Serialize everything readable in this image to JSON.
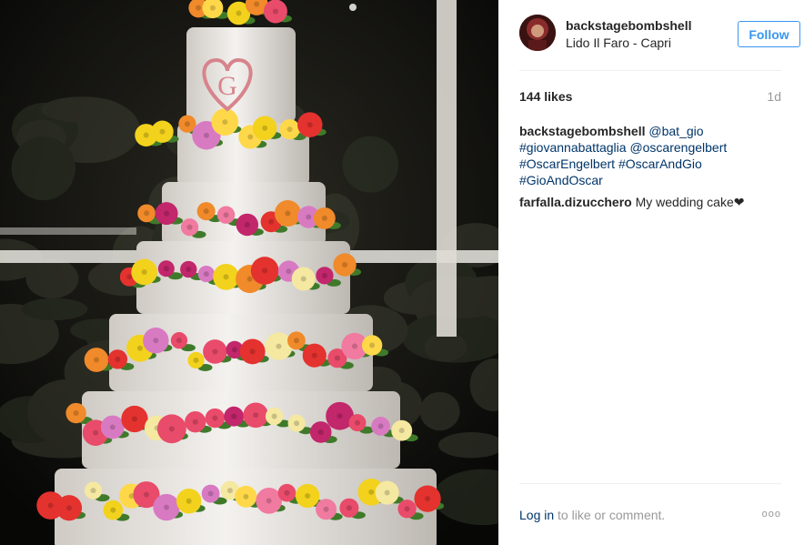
{
  "post": {
    "username": "backstagebombshell",
    "location": "Lido Il Faro - Capri",
    "follow_label": "Follow",
    "likes": "144 likes",
    "time_ago": "1d"
  },
  "comments": [
    {
      "user": "backstagebombshell",
      "text_parts": [
        {
          "text": "@bat_gio",
          "link": true
        },
        {
          "text": "#giovannabattaglia",
          "link": true
        },
        {
          "text": "@oscarengelbert",
          "link": true
        },
        {
          "text": "#OscarEngelbert",
          "link": true
        },
        {
          "text": "#OscarAndGio",
          "link": true
        },
        {
          "text": "#GioAndOscar",
          "link": true
        }
      ]
    },
    {
      "user": "farfalla.dizucchero",
      "text_parts": [
        {
          "text": "My wedding cake❤",
          "link": false
        }
      ]
    }
  ],
  "footer": {
    "login_label": "Log in",
    "prompt": "to like or comment.",
    "more": "ooo"
  },
  "image": {
    "subject": "multi-tier white wedding cake with colorful sugar flowers",
    "monogram": "G"
  }
}
